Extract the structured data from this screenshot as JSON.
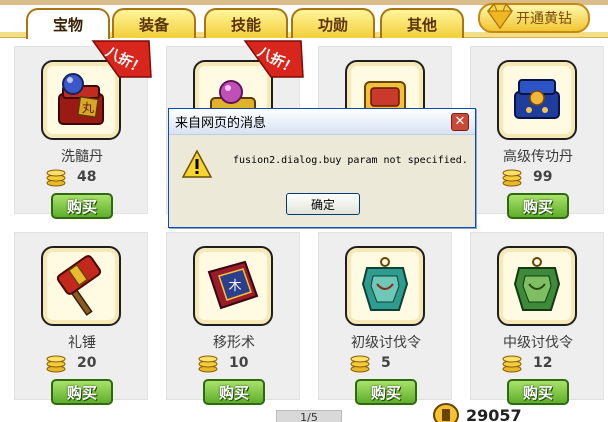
{
  "tabs": [
    {
      "label": "宝物",
      "active": true
    },
    {
      "label": "装备",
      "active": false
    },
    {
      "label": "技能",
      "active": false
    },
    {
      "label": "功勋",
      "active": false
    },
    {
      "label": "其他",
      "active": false
    }
  ],
  "vip_button": {
    "label": "开通黄钻",
    "icon": "diamond-icon"
  },
  "discount_badge": "八折！",
  "buy_label": "购买",
  "items": [
    {
      "name": "洗髓丹",
      "price": "48",
      "icon": "chest-with-orb-icon",
      "badge": true
    },
    {
      "name": "",
      "price": "",
      "icon": "box-with-orb-icon",
      "badge": true
    },
    {
      "name": "",
      "price": "",
      "icon": "treasure-box-icon",
      "badge": false
    },
    {
      "name": "高级传功丹",
      "price": "99",
      "icon": "blue-box-icon",
      "badge": false
    },
    {
      "name": "礼锤",
      "price": "20",
      "icon": "hammer-icon",
      "badge": false
    },
    {
      "name": "移形术",
      "price": "10",
      "icon": "book-icon",
      "badge": false
    },
    {
      "name": "初级讨伐令",
      "price": "5",
      "icon": "token-icon",
      "badge": false
    },
    {
      "name": "中级讨伐令",
      "price": "12",
      "icon": "token-icon",
      "badge": false
    }
  ],
  "pager": "1/5",
  "balance": "29057",
  "dialog": {
    "title": "来自网页的消息",
    "message": "fusion2.dialog.buy param not specified.",
    "ok_label": "确定"
  },
  "colors": {
    "accent": "#f3cf3a",
    "buy_green": "#5fae2a",
    "dialog_border": "#0b4cba"
  }
}
